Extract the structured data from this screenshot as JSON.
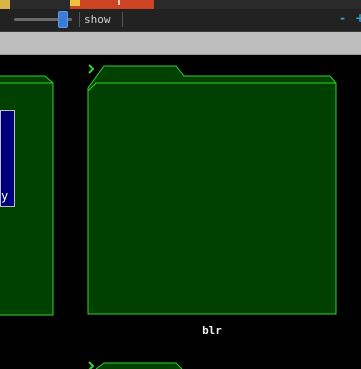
{
  "toolbar": {
    "zoom_slider": 0.85,
    "show_label": "show",
    "minimize_symbol": "-",
    "maximize_symbol": "+"
  },
  "folders": [
    {
      "name": "",
      "preview_text": "y"
    },
    {
      "name": "blr"
    },
    {
      "name": ""
    }
  ],
  "colors": {
    "background": "#000000",
    "folder_fill": "#004000",
    "folder_stroke": "#2fd32f",
    "toolbar": "#222222",
    "pathbar": "#bdbdbd",
    "slider_thumb": "#3a7bd5",
    "active_tab": "#cc4422",
    "preview_bg": "#00007a"
  },
  "icons": [
    "folder-icon",
    "chevron-right-icon",
    "slider-thumb",
    "minimize-icon",
    "maximize-icon"
  ]
}
